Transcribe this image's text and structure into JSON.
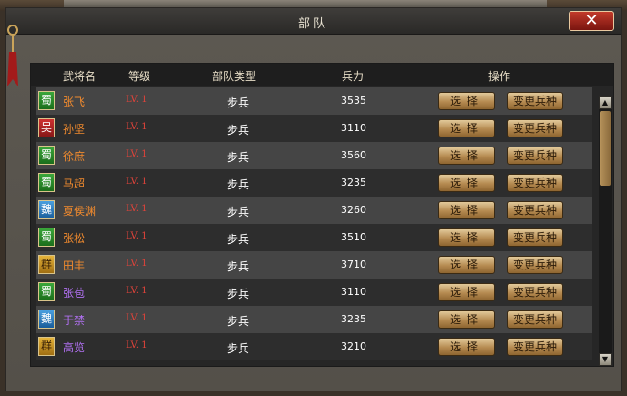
{
  "window": {
    "title": "部队",
    "close_icon": "close-icon"
  },
  "table": {
    "headers": {
      "name": "武将名",
      "level": "等级",
      "unit_type": "部队类型",
      "troops": "兵力",
      "action": "操作"
    },
    "buttons": {
      "select": "选择",
      "change": "变更兵种"
    },
    "rows": [
      {
        "faction": "蜀",
        "name": "张飞",
        "level": "LV. 1",
        "unit_type": "步兵",
        "troops": "3535"
      },
      {
        "faction": "吴",
        "name": "孙坚",
        "level": "LV. 1",
        "unit_type": "步兵",
        "troops": "3110"
      },
      {
        "faction": "蜀",
        "name": "徐庶",
        "level": "LV. 1",
        "unit_type": "步兵",
        "troops": "3560"
      },
      {
        "faction": "蜀",
        "name": "马超",
        "level": "LV. 1",
        "unit_type": "步兵",
        "troops": "3235"
      },
      {
        "faction": "魏",
        "name": "夏侯渊",
        "level": "LV. 1",
        "unit_type": "步兵",
        "troops": "3260"
      },
      {
        "faction": "蜀",
        "name": "张松",
        "level": "LV. 1",
        "unit_type": "步兵",
        "troops": "3510"
      },
      {
        "faction": "群",
        "name": "田丰",
        "level": "LV. 1",
        "unit_type": "步兵",
        "troops": "3710"
      },
      {
        "faction": "蜀",
        "name": "张苞",
        "level": "LV. 1",
        "unit_type": "步兵",
        "troops": "3110"
      },
      {
        "faction": "魏",
        "name": "于禁",
        "level": "LV. 1",
        "unit_type": "步兵",
        "troops": "3235"
      },
      {
        "faction": "群",
        "name": "高览",
        "level": "LV. 1",
        "unit_type": "步兵",
        "troops": "3210"
      }
    ]
  },
  "colors": {
    "shu": "#2a8a2a",
    "wu": "#b02222",
    "wei": "#2a7cc0",
    "qun": "#d09a28",
    "name_orange": "#f08a2e",
    "name_purple": "#b070f0",
    "level_red": "#e0433a"
  },
  "name_colors": [
    "orange",
    "orange",
    "orange",
    "orange",
    "orange",
    "orange",
    "orange",
    "purple",
    "purple",
    "purple"
  ],
  "scrollbar": {
    "up_icon": "arrow-up-icon",
    "down_icon": "arrow-down-icon"
  }
}
